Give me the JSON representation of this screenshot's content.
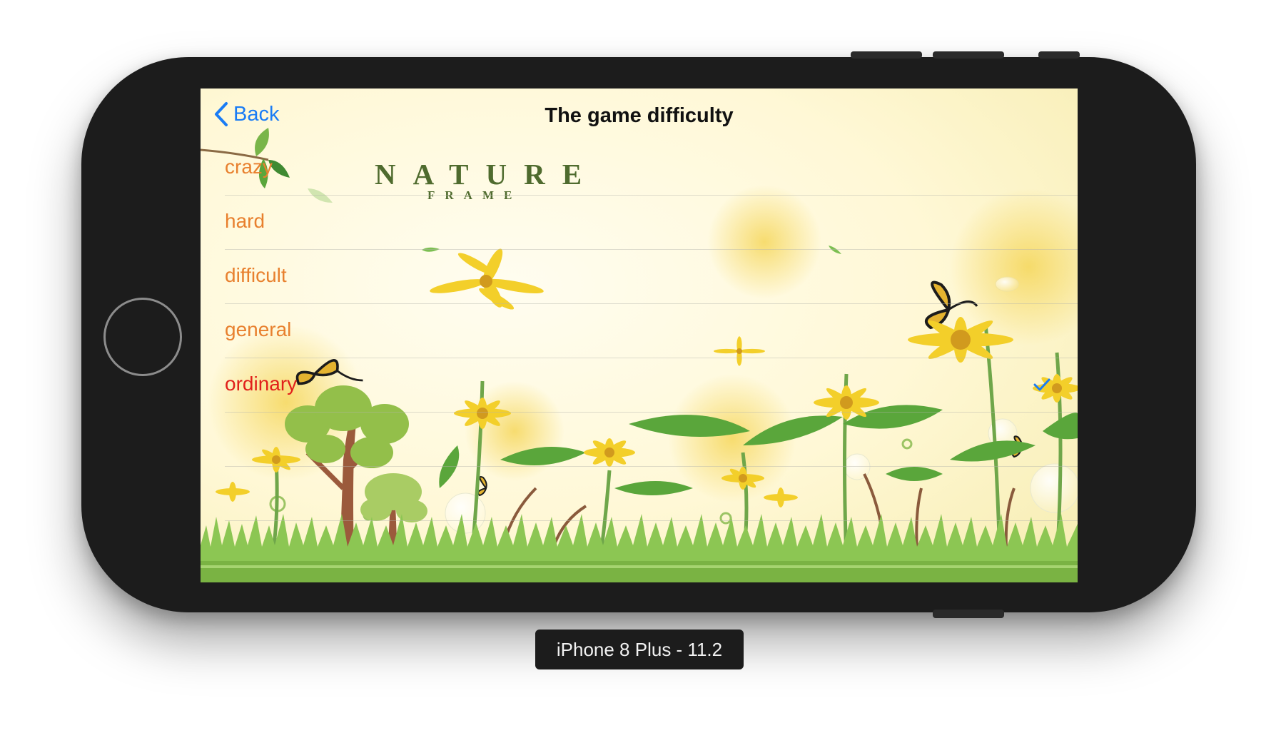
{
  "navbar": {
    "back_label": "Back",
    "title": "The game difficulty"
  },
  "logo": {
    "main": "NATURE",
    "sub": "FRAME"
  },
  "difficulty_options": [
    {
      "label": "crazy",
      "selected": false
    },
    {
      "label": "hard",
      "selected": false
    },
    {
      "label": "difficult",
      "selected": false
    },
    {
      "label": "general",
      "selected": false
    },
    {
      "label": "ordinary",
      "selected": true
    }
  ],
  "simulator_caption": "iPhone 8 Plus - 11.2",
  "colors": {
    "accent": "#1a7cf5",
    "option_text": "#e8802e",
    "selected_text": "#e1201b",
    "device_body": "#1c1c1c"
  },
  "icons": [
    "chevron-left-icon",
    "checkmark-icon",
    "home-button"
  ]
}
